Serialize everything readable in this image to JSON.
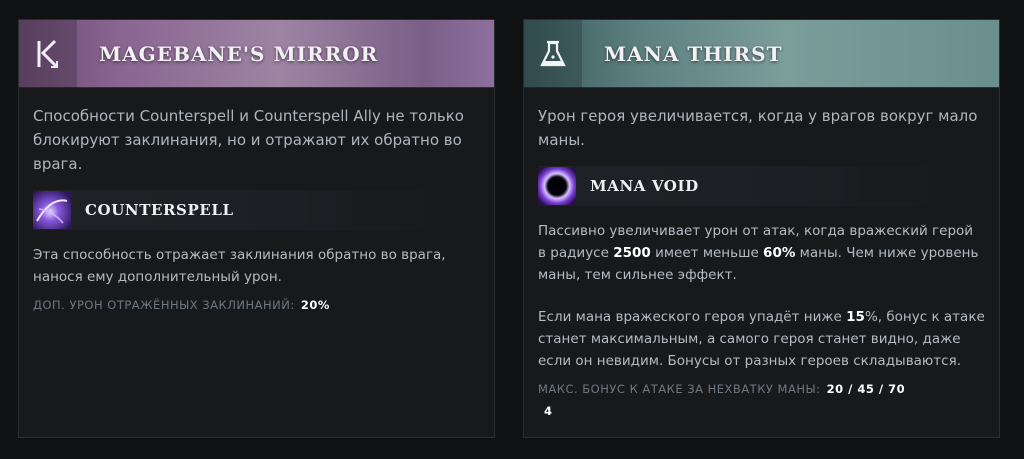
{
  "left": {
    "title": "MAGEBANE'S MIRROR",
    "icon": "magebane-mirror-icon",
    "description": "Способности Counterspell и Counterspell Ally не только блокируют заклинания, но и отражают их обратно во врага.",
    "ability": {
      "name": "COUNTERSPELL",
      "icon": "counterspell-icon",
      "description": "Эта способность отражает заклинания обратно во врага, нанося ему дополнительный урон.",
      "stat_label": "ДОП. УРОН ОТРАЖЁННЫХ ЗАКЛИНАНИЙ:",
      "stat_value": "20%"
    },
    "colors": {
      "header_start": "#6c4c72",
      "header_end": "#8e6f9d"
    }
  },
  "right": {
    "title": "MANA THIRST",
    "icon": "mana-thirst-icon",
    "description": "Урон героя увеличивается, когда у врагов вокруг мало маны.",
    "ability": {
      "name": "MANA VOID",
      "icon": "mana-void-icon",
      "desc1": {
        "a": "Пассивно увеличивает урон от атак, когда вражеский герой в радиусе",
        "v1": "2500",
        "b": "имеет меньше",
        "v2": "60%",
        "c": "маны. Чем ниже уровень маны, тем сильнее эффект."
      },
      "desc2": {
        "a": "Если мана вражеского героя упадёт ниже",
        "v1": "15",
        "b": "%, бонус к атаке станет максимальным, а самого героя станет видно, даже если он невидим. Бонусы от разных героев складываются."
      },
      "stat_label": "МАКС. БОНУС К АТАКЕ ЗА НЕХВАТКУ МАНЫ:",
      "stat_value": "20 / 45 / 70",
      "extra": "4"
    },
    "colors": {
      "header_start": "#3c5c5d",
      "header_end": "#6a8f8d"
    }
  }
}
